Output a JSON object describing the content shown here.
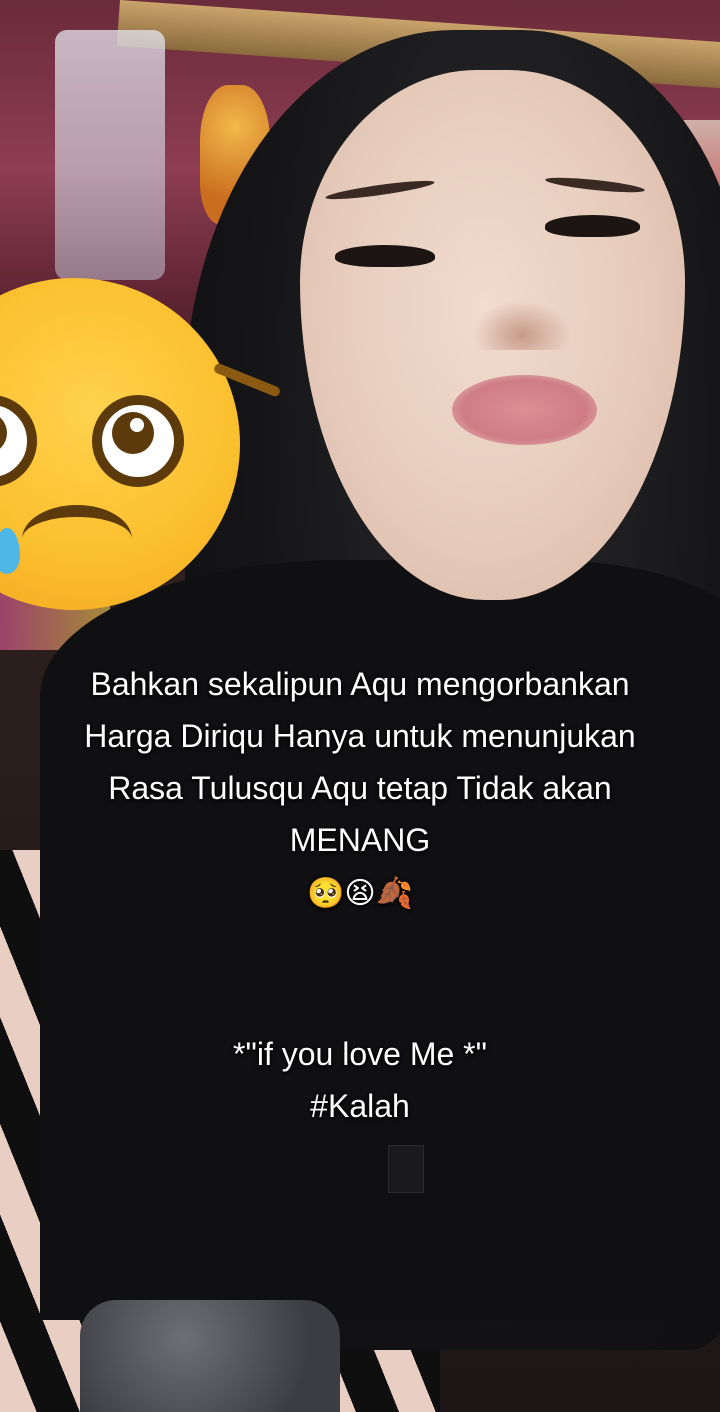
{
  "caption": {
    "lines": [
      "Bahkan sekalipun Aqu mengorbankan",
      "Harga Diriqu Hanya untuk menunjukan",
      "Rasa Tulusqu Aqu tetap Tidak akan",
      "MENANG"
    ],
    "emoji_line": "🥺😫🍂",
    "tail_lines": [
      "*\"if you love Me *\"",
      "#Kalah"
    ]
  },
  "sticker": {
    "icon": "pleading-face-emoji",
    "color": "#fbbf2d"
  },
  "colors": {
    "text": "#ffffff",
    "hijab": "#121214"
  }
}
